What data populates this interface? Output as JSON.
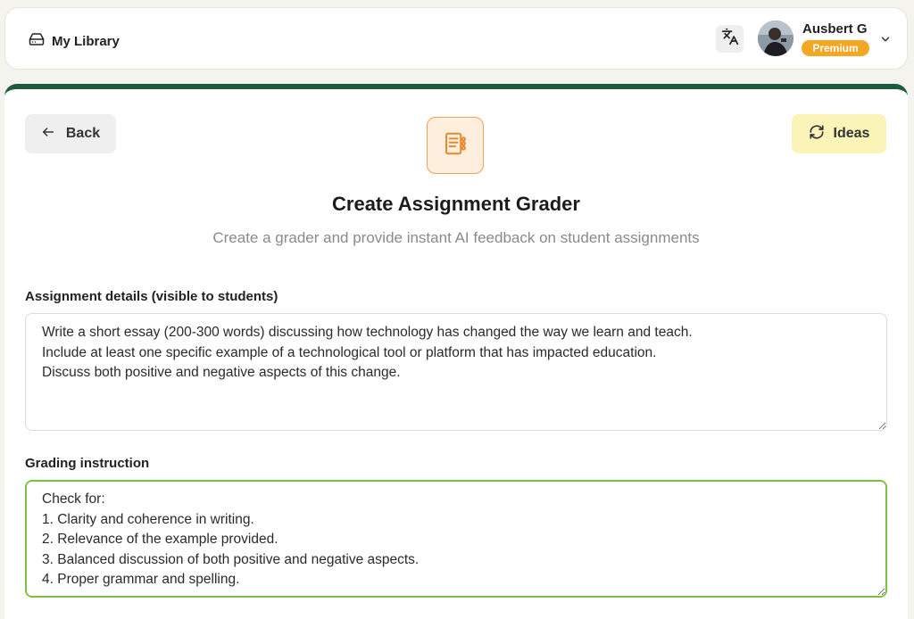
{
  "header": {
    "library_label": "My Library",
    "user_name": "Ausbert G",
    "badge": "Premium"
  },
  "toolbar": {
    "back_label": "Back",
    "ideas_label": "Ideas"
  },
  "page": {
    "title": "Create Assignment Grader",
    "subtitle": "Create a grader and provide instant AI feedback on student assignments"
  },
  "fields": {
    "details_label": "Assignment details (visible to students)",
    "details_value": "Write a short essay (200-300 words) discussing how technology has changed the way we learn and teach.\nInclude at least one specific example of a technological tool or platform that has impacted education.\nDiscuss both positive and negative aspects of this change.",
    "grading_label": "Grading instruction",
    "grading_value": "Check for:\n1. Clarity and coherence in writing.\n2. Relevance of the example provided.\n3. Balanced discussion of both positive and negative aspects.\n4. Proper grammar and spelling."
  },
  "colors": {
    "brand_green": "#1a5c3c",
    "premium_orange": "#f5a623",
    "ideas_yellow": "#fbf4b8",
    "focus_green": "#7cc242",
    "icon_orange": "#f3a25a"
  },
  "icons": {
    "library": "hard-drive-icon",
    "translate": "translate-icon",
    "chevron": "chevron-down-icon",
    "back": "arrow-left-icon",
    "ideas": "refresh-icon",
    "tool": "notebook-checklist-icon"
  }
}
